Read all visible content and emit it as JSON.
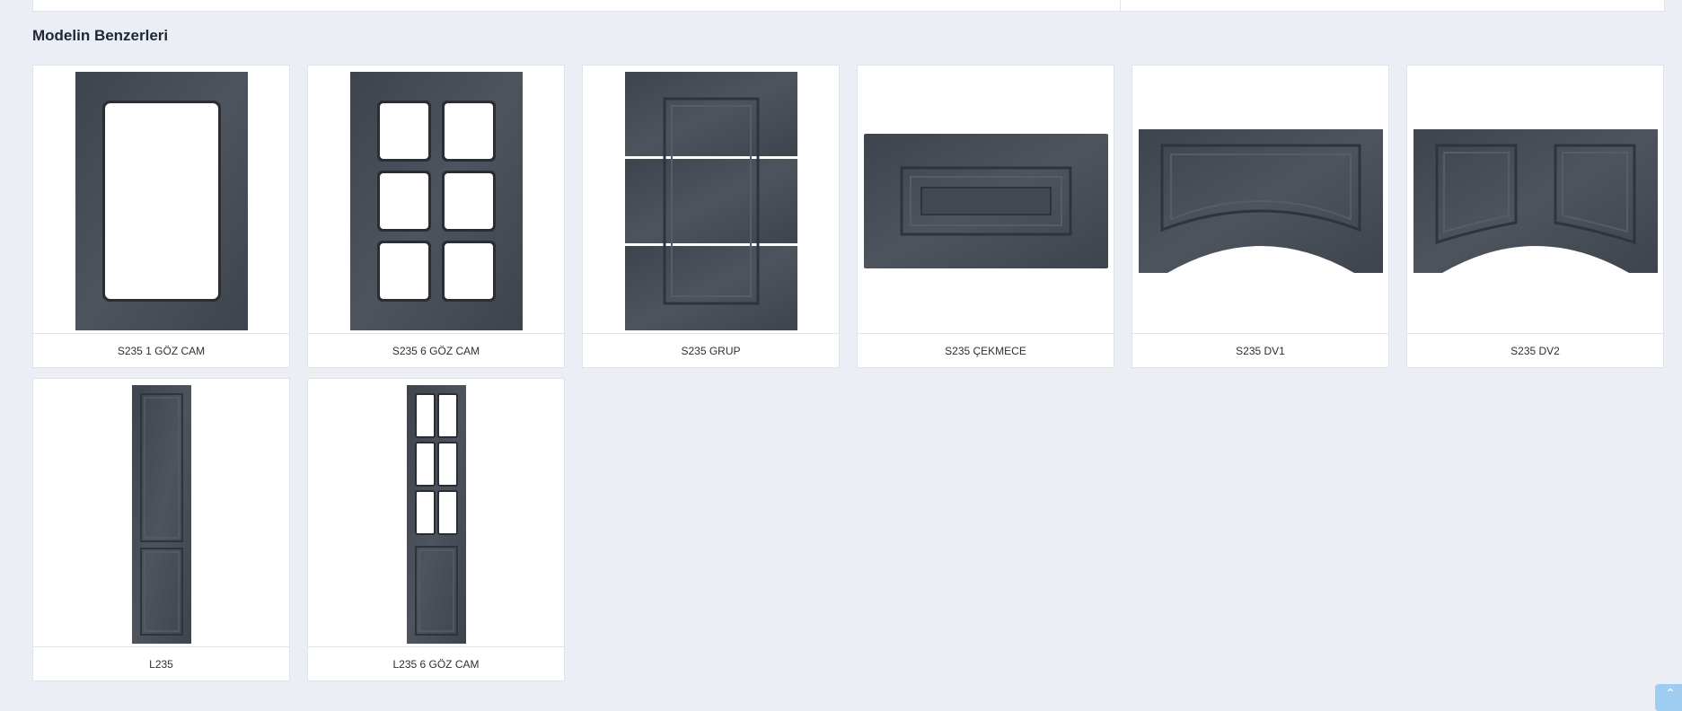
{
  "section": {
    "title": "Modelin Benzerleri"
  },
  "colors": {
    "panel": "#464c56",
    "panel_edge": "#2f343b",
    "background": "#ebeef5",
    "scroll_button": "#9fcdf1"
  },
  "products": [
    {
      "name": "S235 1 GÖZ CAM",
      "icon": "door-glass-1-icon"
    },
    {
      "name": "S235 6 GÖZ CAM",
      "icon": "door-glass-6-icon"
    },
    {
      "name": "S235 GRUP",
      "icon": "door-group-icon"
    },
    {
      "name": "S235 ÇEKMECE",
      "icon": "drawer-front-icon"
    },
    {
      "name": "S235 DV1",
      "icon": "valance-arch-1-icon"
    },
    {
      "name": "S235 DV2",
      "icon": "valance-arch-2-icon"
    },
    {
      "name": "L235",
      "icon": "tall-door-icon"
    },
    {
      "name": "L235 6 GÖZ CAM",
      "icon": "tall-door-glass-6-icon"
    }
  ],
  "scroll_top": {
    "icon": "chevron-up-icon",
    "glyph": "⌃"
  }
}
